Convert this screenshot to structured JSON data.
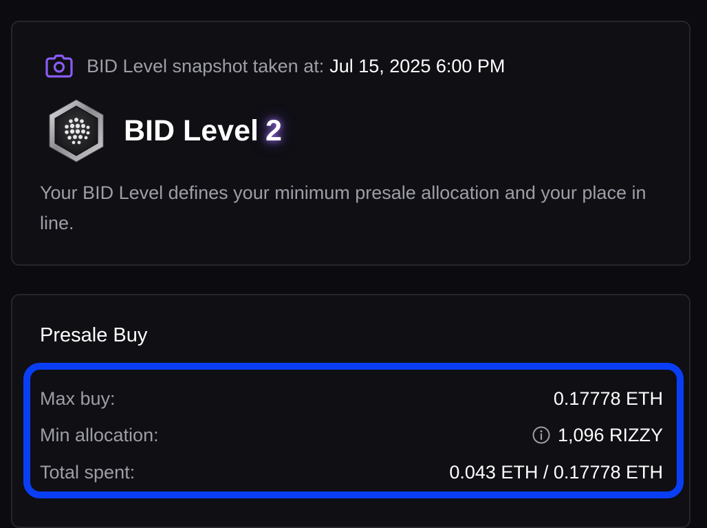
{
  "snapshot": {
    "icon": "camera-icon",
    "label": "BID Level snapshot taken at:",
    "value": "Jul 15, 2025 6:00 PM"
  },
  "level": {
    "badge_icon": "hexagon-badge-icon",
    "title": "BID Level",
    "number": "2",
    "description": "Your BID Level defines your minimum presale allocation and your place in line."
  },
  "presale": {
    "title": "Presale Buy",
    "rows": [
      {
        "label": "Max buy:",
        "value": "0.17778 ETH"
      },
      {
        "label": "Min allocation:",
        "value": "1,096 RIZZY",
        "icon": "info-icon"
      },
      {
        "label": "Total spent:",
        "value": "0.043 ETH / 0.17778 ETH"
      }
    ]
  },
  "colors": {
    "accent_purple": "#8b5cf6",
    "highlight_blue": "#0a3ef5",
    "background": "#0b0b10",
    "muted_text": "#9e9ea7"
  }
}
